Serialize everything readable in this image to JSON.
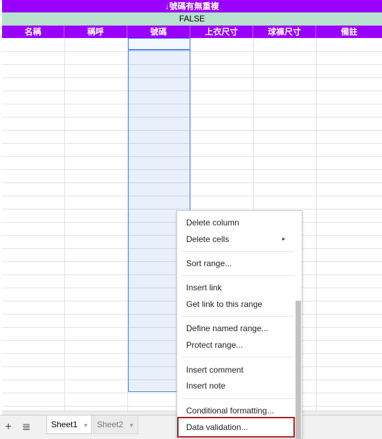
{
  "title_bar": {
    "text": "↓號碼有無重複"
  },
  "formula_bar": {
    "text": "FALSE"
  },
  "columns": [
    "名稱",
    "稱呼",
    "號碼",
    "上衣尺寸",
    "球褲尺寸",
    "備註"
  ],
  "context_menu": {
    "groups": [
      [
        {
          "label": "Delete column"
        },
        {
          "label": "Delete cells",
          "submenu": "►"
        }
      ],
      [
        {
          "label": "Sort range..."
        }
      ],
      [
        {
          "label": "Insert link"
        },
        {
          "label": "Get link to this range"
        }
      ],
      [
        {
          "label": "Define named range..."
        },
        {
          "label": "Protect range..."
        }
      ],
      [
        {
          "label": "Insert comment"
        },
        {
          "label": "Insert note"
        }
      ],
      [
        {
          "label": "Conditional formatting..."
        },
        {
          "label": "Data validation..."
        }
      ]
    ]
  },
  "sheet_tabs": [
    {
      "label": "Sheet1",
      "active": true
    },
    {
      "label": "Sheet2",
      "active": false
    }
  ],
  "bottom_bar": {
    "add_sheet_symbol": "+",
    "all_sheets_symbol": "≣"
  },
  "colors": {
    "header_purple": "#9900ff",
    "formula_green": "#b7e1cd",
    "selection_blue": "#4a86e8",
    "highlight_red": "#a31f1f"
  }
}
